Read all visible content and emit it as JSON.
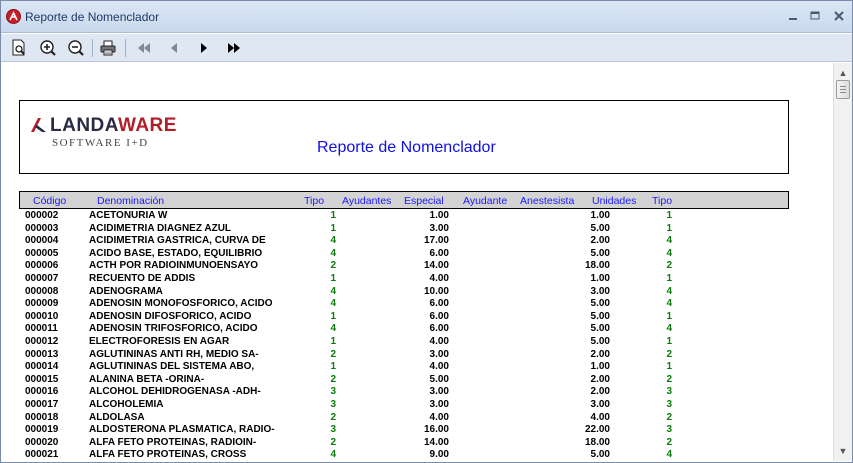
{
  "window": {
    "title": "Reporte de Nomenclador"
  },
  "report": {
    "logo_name_a": "LANDA",
    "logo_name_b": "WARE",
    "logo_tagline": "SOFTWARE I+D",
    "title": "Reporte de Nomenclador",
    "columns": [
      "Código",
      "Denominación",
      "Tipo",
      "Ayudantes",
      "Especial",
      "Ayudante",
      "Anestesista",
      "Unidades",
      "Tipo"
    ],
    "rows": [
      {
        "code": "000002",
        "name": "ACETONURIA   W",
        "tipo": "1",
        "especial": "1.00",
        "unidades": "1.00",
        "tipo2": "1"
      },
      {
        "code": "000003",
        "name": "ACIDIMETRIA DIAGNEZ AZUL",
        "tipo": "1",
        "especial": "3.00",
        "unidades": "5.00",
        "tipo2": "1"
      },
      {
        "code": "000004",
        "name": "ACIDIMETRIA GASTRICA, CURVA DE",
        "tipo": "4",
        "especial": "17.00",
        "unidades": "2.00",
        "tipo2": "4"
      },
      {
        "code": "000005",
        "name": "ACIDO BASE, ESTADO, EQUILIBRIO",
        "tipo": "4",
        "especial": "6.00",
        "unidades": "5.00",
        "tipo2": "4"
      },
      {
        "code": "000006",
        "name": "ACTH POR RADIOINMUNOENSAYO",
        "tipo": "2",
        "especial": "14.00",
        "unidades": "18.00",
        "tipo2": "2"
      },
      {
        "code": "000007",
        "name": "RECUENTO DE ADDIS",
        "tipo": "1",
        "especial": "4.00",
        "unidades": "1.00",
        "tipo2": "1"
      },
      {
        "code": "000008",
        "name": "ADENOGRAMA",
        "tipo": "4",
        "especial": "10.00",
        "unidades": "3.00",
        "tipo2": "4"
      },
      {
        "code": "000009",
        "name": "ADENOSIN MONOFOSFORICO, ACIDO",
        "tipo": "4",
        "especial": "6.00",
        "unidades": "5.00",
        "tipo2": "4"
      },
      {
        "code": "000010",
        "name": "ADENOSIN DIFOSFORICO, ACIDO",
        "tipo": "1",
        "especial": "6.00",
        "unidades": "5.00",
        "tipo2": "1"
      },
      {
        "code": "000011",
        "name": "ADENOSIN TRIFOSFORICO, ACIDO",
        "tipo": "4",
        "especial": "6.00",
        "unidades": "5.00",
        "tipo2": "4"
      },
      {
        "code": "000012",
        "name": "ELECTROFORESIS EN AGAR",
        "tipo": "1",
        "especial": "4.00",
        "unidades": "5.00",
        "tipo2": "1"
      },
      {
        "code": "000013",
        "name": "AGLUTININAS ANTI RH, MEDIO SA-",
        "tipo": "2",
        "especial": "3.00",
        "unidades": "2.00",
        "tipo2": "2"
      },
      {
        "code": "000014",
        "name": "AGLUTININAS DEL SISTEMA ABO,",
        "tipo": "1",
        "especial": "4.00",
        "unidades": "1.00",
        "tipo2": "1"
      },
      {
        "code": "000015",
        "name": "ALANINA BETA -ORINA-",
        "tipo": "2",
        "especial": "5.00",
        "unidades": "2.00",
        "tipo2": "2"
      },
      {
        "code": "000016",
        "name": "ALCOHOL DEHIDROGENASA -ADH-",
        "tipo": "3",
        "especial": "3.00",
        "unidades": "2.00",
        "tipo2": "3"
      },
      {
        "code": "000017",
        "name": "ALCOHOLEMIA",
        "tipo": "3",
        "especial": "3.00",
        "unidades": "3.00",
        "tipo2": "3"
      },
      {
        "code": "000018",
        "name": "ALDOLASA",
        "tipo": "2",
        "especial": "4.00",
        "unidades": "4.00",
        "tipo2": "2"
      },
      {
        "code": "000019",
        "name": "ALDOSTERONA PLASMATICA, RADIO-",
        "tipo": "3",
        "especial": "16.00",
        "unidades": "22.00",
        "tipo2": "3"
      },
      {
        "code": "000020",
        "name": "ALFA FETO PROTEINAS, RADIOIN-",
        "tipo": "2",
        "especial": "14.00",
        "unidades": "18.00",
        "tipo2": "2"
      },
      {
        "code": "000021",
        "name": "ALFA FETO PROTEINAS, CROSS",
        "tipo": "4",
        "especial": "9.00",
        "unidades": "5.00",
        "tipo2": "4"
      }
    ]
  },
  "colors": {
    "title_blue": "#1010e0",
    "header_text": "#1a1aff",
    "value_green": "#0a7a0a",
    "brand_red": "#b21e28"
  }
}
